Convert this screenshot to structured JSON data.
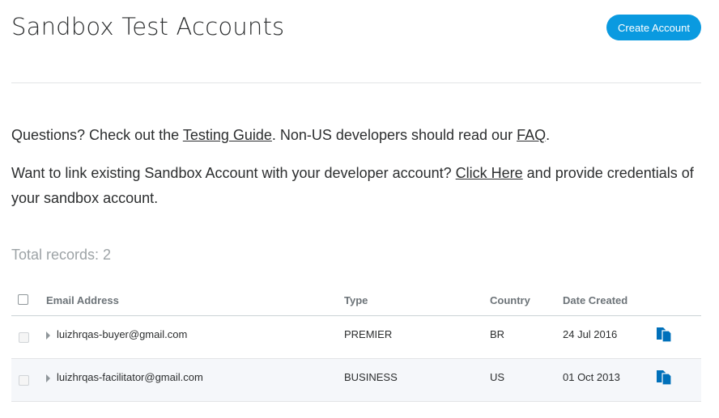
{
  "header": {
    "title": "Sandbox Test Accounts",
    "create_label": "Create Account"
  },
  "info": {
    "q_prefix": "Questions? Check out the ",
    "testing_guide": "Testing Guide",
    "q_middle": ". Non-US developers should read our ",
    "faq": "FAQ",
    "q_suffix": ".",
    "link_prefix": "Want to link existing Sandbox Account with your developer account? ",
    "click_here": "Click Here",
    "link_suffix": " and provide credentials of your sandbox account."
  },
  "records": {
    "label": "Total records: ",
    "count": "2"
  },
  "table": {
    "headers": {
      "email": "Email Address",
      "type": "Type",
      "country": "Country",
      "date": "Date Created"
    },
    "rows": [
      {
        "email": "luizhrqas-buyer@gmail.com",
        "type": "PREMIER",
        "country": "BR",
        "date": "24 Jul 2016"
      },
      {
        "email": "luizhrqas-facilitator@gmail.com",
        "type": "BUSINESS",
        "country": "US",
        "date": "01 Oct 2013"
      }
    ]
  },
  "icons": {
    "copy": "copy-icon",
    "expand": "caret-right-icon"
  },
  "colors": {
    "accent": "#0a9ae0",
    "icon_blue": "#0070ba",
    "muted": "#9da3a6"
  }
}
